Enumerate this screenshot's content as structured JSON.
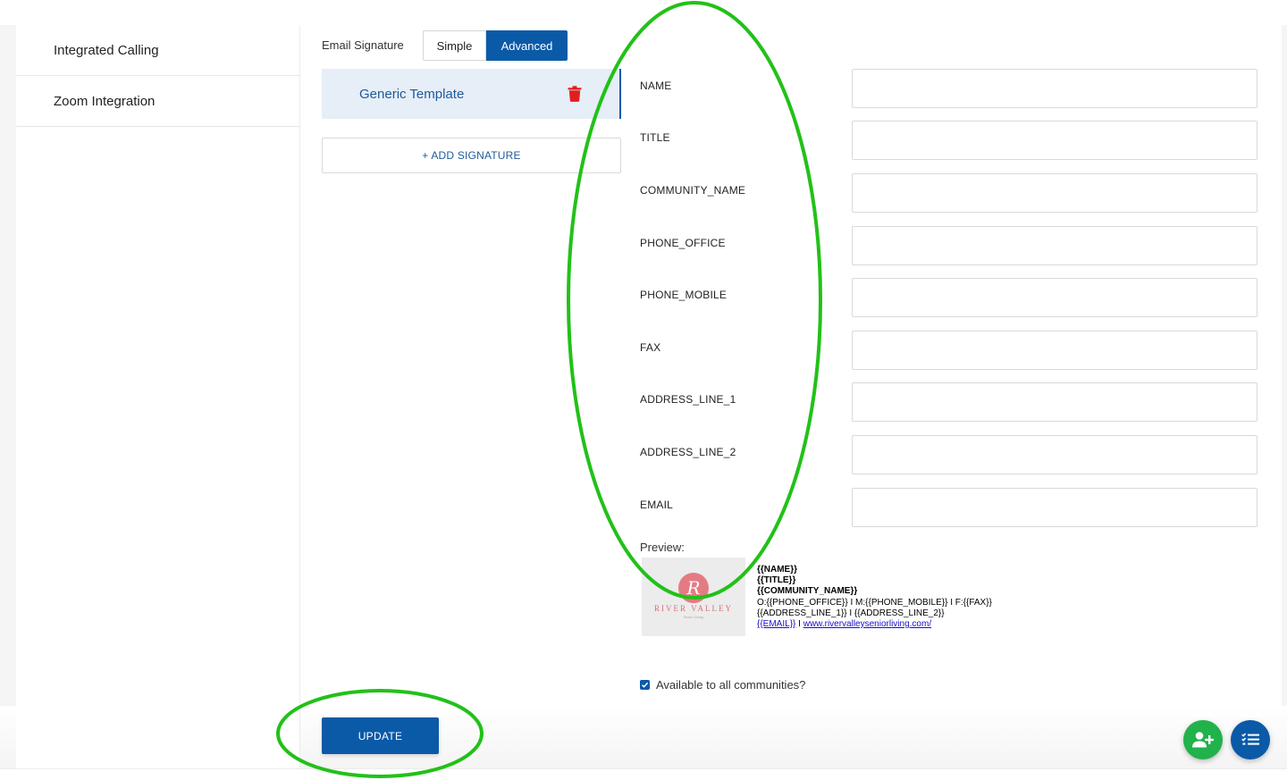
{
  "sidebar": {
    "items": [
      {
        "label": "Integrated Calling"
      },
      {
        "label": "Zoom Integration"
      }
    ]
  },
  "signature": {
    "label": "Email Signature",
    "modes": [
      "Simple",
      "Advanced"
    ],
    "active_mode": "Advanced"
  },
  "templates": [
    {
      "name": "Generic Template",
      "delete_icon": "trash-icon"
    }
  ],
  "add_signature_label": "+ ADD SIGNATURE",
  "fields": [
    {
      "label": "NAME",
      "value": ""
    },
    {
      "label": "TITLE",
      "value": ""
    },
    {
      "label": "COMMUNITY_NAME",
      "value": ""
    },
    {
      "label": "PHONE_OFFICE",
      "value": ""
    },
    {
      "label": "PHONE_MOBILE",
      "value": ""
    },
    {
      "label": "FAX",
      "value": ""
    },
    {
      "label": "ADDRESS_LINE_1",
      "value": ""
    },
    {
      "label": "ADDRESS_LINE_2",
      "value": ""
    },
    {
      "label": "EMAIL",
      "value": ""
    }
  ],
  "preview": {
    "label": "Preview:",
    "logo": {
      "monogram": "R",
      "brand": "RIVER VALLEY",
      "tagline": "Senior Living"
    },
    "lines": {
      "name": "{{NAME}}",
      "title": "{{TITLE}}",
      "community": "{{COMMUNITY_NAME}}",
      "phones": "O:{{PHONE_OFFICE}} I M:{{PHONE_MOBILE}} I F:{{FAX}}",
      "address": "{{ADDRESS_LINE_1}} I {{ADDRESS_LINE_2}}",
      "email": "{{EMAIL}}",
      "separator": " I ",
      "website": "www.rivervalleyseniorliving.com/"
    }
  },
  "available_all": {
    "label": "Available to all communities?",
    "checked": true
  },
  "update_label": "UPDATE",
  "fabs": [
    {
      "icon": "add-person-icon",
      "color": "#21b24b"
    },
    {
      "icon": "task-list-icon",
      "color": "#0a5aa8"
    }
  ],
  "colors": {
    "primary": "#0a5aa8",
    "annotation": "#22c118",
    "danger": "#e02020"
  }
}
